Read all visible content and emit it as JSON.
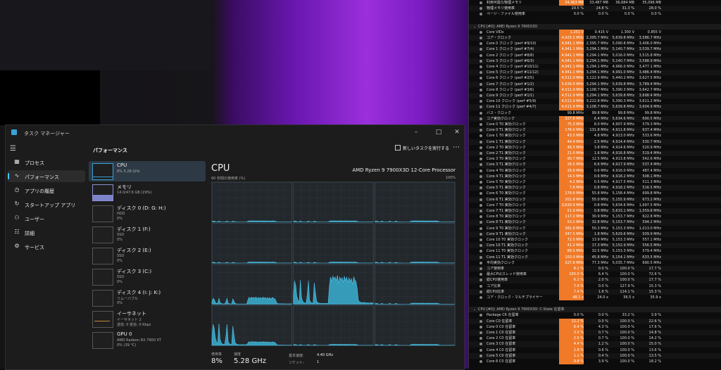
{
  "task_manager": {
    "title": "タスク マネージャー",
    "nav": [
      {
        "label": "プロセス",
        "icon": "grid-icon"
      },
      {
        "label": "パフォーマンス",
        "icon": "performance-icon"
      },
      {
        "label": "アプリの履歴",
        "icon": "history-icon"
      },
      {
        "label": "スタートアップ アプリ",
        "icon": "startup-icon"
      },
      {
        "label": "ユーザー",
        "icon": "users-icon"
      },
      {
        "label": "詳細",
        "icon": "list-icon"
      },
      {
        "label": "サービス",
        "icon": "gear-icon"
      }
    ],
    "header": {
      "title": "パフォーマンス",
      "run_task": "新しいタスクを実行する"
    },
    "resources": [
      {
        "name": "CPU",
        "line1": "8%  5.28 GHz",
        "line2": ""
      },
      {
        "name": "メモリ",
        "line1": "14.0/47.6 GB (29%)",
        "line2": ""
      },
      {
        "name": "ディスク 0 (D: G: H:)",
        "line1": "HDD",
        "line2": "0%"
      },
      {
        "name": "ディスク 1 (F:)",
        "line1": "SSD",
        "line2": "0%"
      },
      {
        "name": "ディスク 2 (E:)",
        "line1": "SSD",
        "line2": "0%"
      },
      {
        "name": "ディスク 3 (C:)",
        "line1": "SSD",
        "line2": "0%"
      },
      {
        "name": "ディスク 4 (I: J: K:)",
        "line1": "リムーバブル",
        "line2": "0%"
      },
      {
        "name": "イーサネット",
        "line1": "イーサネット 2",
        "line2": "送信: 0 受信: 0 Kbps"
      },
      {
        "name": "GPU 0",
        "line1": "AMD Radeon RX 7900 XT",
        "line2": "0% (39 °C)"
      }
    ],
    "detail": {
      "title": "CPU",
      "model": "AMD Ryzen 9 7900X3D 12-Core Processor",
      "graph_caption": "60 秒間の使用率 (%)",
      "graph_max": "100%",
      "usage_label": "使用率",
      "usage_value": "8%",
      "speed_label": "速度",
      "speed_value": "5.28 GHz",
      "base_speed_label": "基本速度:",
      "base_speed_value": "4.40 GHz",
      "sockets_label": "ソケット:",
      "sockets_value": "1"
    }
  },
  "hwinfo": {
    "highlight_color": "#f07a28",
    "rows": [
      {
        "t": "row",
        "name": "利用可能な物理メモリ",
        "v": [
          "34,463 MB",
          "33,487 MB",
          "36,684 MB",
          "35,096 MB"
        ],
        "hl": true
      },
      {
        "t": "row",
        "name": "物理メモリ使用率",
        "v": [
          "29.5 %",
          "24.8 %",
          "31.3 %",
          "28.0 %"
        ]
      },
      {
        "t": "row",
        "name": "ページ・ファイル使用率",
        "v": [
          "0.0 %",
          "0.0 %",
          "0.0 %",
          "0.0 %"
        ]
      },
      {
        "t": "gap"
      },
      {
        "t": "sec",
        "name": "CPU [#0]: AMD Ryzen 9 7900X3D"
      },
      {
        "t": "row",
        "name": "Core VIDs",
        "v": [
          "1.251 V",
          "0.415 V",
          "1.300 V",
          "0.855 V"
        ],
        "hl": true
      },
      {
        "t": "row",
        "name": "コア・クロック",
        "v": [
          "4,925.5 MHz",
          "2,395.7 MHz",
          "5,639.8 MHz",
          "3,586.7 MHz"
        ],
        "hl": true
      },
      {
        "t": "row",
        "name": "Core 0 クロック (perf #9/10)",
        "v": [
          "4,941.1 MHz",
          "2,395.7 MHz",
          "5,090.8 MHz",
          "3,406.0 MHz"
        ],
        "hl": true
      },
      {
        "t": "row",
        "name": "Core 1 クロック (perf #7/4)",
        "v": [
          "4,941.1 MHz",
          "3,294.1 MHz",
          "5,140.7 MHz",
          "3,539.7 MHz"
        ],
        "hl": true
      },
      {
        "t": "row",
        "name": "Core 2 クロック (perf #8/8)",
        "v": [
          "4,941.1 MHz",
          "3,294.1 MHz",
          "5,016.0 MHz",
          "3,515.8 MHz"
        ],
        "hl": true
      },
      {
        "t": "row",
        "name": "Core 3 クロック (perf #6/3)",
        "v": [
          "4,941.1 MHz",
          "3,294.1 MHz",
          "5,140.7 MHz",
          "3,588.9 MHz"
        ],
        "hl": true
      },
      {
        "t": "row",
        "name": "Core 4 クロック (perf #10/11)",
        "v": [
          "4,941.1 MHz",
          "3,294.1 MHz",
          "4,966.0 MHz",
          "3,477.1 MHz"
        ],
        "hl": true
      },
      {
        "t": "row",
        "name": "Core 5 クロック (perf #11/12)",
        "v": [
          "4,941.1 MHz",
          "3,294.1 MHz",
          "4,991.0 MHz",
          "3,486.4 MHz"
        ],
        "hl": true
      },
      {
        "t": "row",
        "name": "Core 6 クロック (perf #2/5)",
        "v": [
          "4,511.9 MHz",
          "3,122.9 MHz",
          "5,440.2 MHz",
          "3,627.5 MHz"
        ],
        "hl": true
      },
      {
        "t": "row",
        "name": "Core 7 クロック (perf #1/2)",
        "v": [
          "5,639.8 MHz",
          "3,294.1 MHz",
          "5,639.8 MHz",
          "3,789.4 MHz"
        ],
        "hl": true
      },
      {
        "t": "row",
        "name": "Core 8 クロック (perf #3/6)",
        "v": [
          "4,511.9 MHz",
          "3,108.7 MHz",
          "5,390.3 MHz",
          "3,642.7 MHz"
        ],
        "hl": true
      },
      {
        "t": "row",
        "name": "Core 9 クロック (perf #1/1)",
        "v": [
          "4,511.9 MHz",
          "3,294.1 MHz",
          "5,639.8 MHz",
          "3,698.4 MHz"
        ],
        "hl": true
      },
      {
        "t": "row",
        "name": "Core 10 クロック (perf #5/9)",
        "v": [
          "4,511.9 MHz",
          "3,222.8 MHz",
          "5,390.3 MHz",
          "3,611.2 MHz"
        ],
        "hl": true
      },
      {
        "t": "row",
        "name": "Core 11 クロック (perf #4/7)",
        "v": [
          "4,511.9 MHz",
          "3,108.7 MHz",
          "5,639.8 MHz",
          "3,604.9 MHz"
        ],
        "hl": true
      },
      {
        "t": "row",
        "name": "バス・クロック",
        "v": [
          "99.8 MHz",
          "99.8 MHz",
          "99.8 MHz",
          "99.8 MHz"
        ]
      },
      {
        "t": "row",
        "name": "コア実効クロック",
        "v": [
          "327.8 MHz",
          "6.4 MHz",
          "5,634.6 MHz",
          "690.5 MHz"
        ],
        "hl": true
      },
      {
        "t": "row",
        "name": "Core 0 T0 実効クロック",
        "v": [
          "75.3 MHz",
          "8.0 MHz",
          "4,907.9 MHz",
          "579.3 MHz"
        ],
        "hl": true
      },
      {
        "t": "row",
        "name": "Core 0 T1 実効クロック",
        "v": [
          "176.6 MHz",
          "131.8 MHz",
          "4,911.8 MHz",
          "637.4 MHz"
        ],
        "hl": true
      },
      {
        "t": "row",
        "name": "Core 1 T0 実効クロック",
        "v": [
          "43.5 MHz",
          "4.8 MHz",
          "4,913.0 MHz",
          "533.6 MHz"
        ],
        "hl": true
      },
      {
        "t": "row",
        "name": "Core 1 T1 実効クロック",
        "v": [
          "44.9 MHz",
          "2.5 MHz",
          "4,914.4 MHz",
          "530.7 MHz"
        ],
        "hl": true
      },
      {
        "t": "row",
        "name": "Core 2 T0 実効クロック",
        "v": [
          "46.5 MHz",
          "3.8 MHz",
          "4,914.6 MHz",
          "520.9 MHz"
        ],
        "hl": true
      },
      {
        "t": "row",
        "name": "Core 2 T1 実効クロック",
        "v": [
          "21.0 MHz",
          "1.6 MHz",
          "4,916.8 MHz",
          "519.4 MHz"
        ],
        "hl": true
      },
      {
        "t": "row",
        "name": "Core 3 T0 実効クロック",
        "v": [
          "90.7 MHz",
          "12.5 MHz",
          "4,913.8 MHz",
          "542.6 MHz"
        ],
        "hl": true
      },
      {
        "t": "row",
        "name": "Core 3 T1 実効クロック",
        "v": [
          "28.5 MHz",
          "6.6 MHz",
          "4,917.9 MHz",
          "537.4 MHz"
        ],
        "hl": true
      },
      {
        "t": "row",
        "name": "Core 4 T0 実効クロック",
        "v": [
          "26.6 MHz",
          "0.6 MHz",
          "4,916.0 MHz",
          "487.4 MHz"
        ],
        "hl": true
      },
      {
        "t": "row",
        "name": "Core 4 T1 実効クロック",
        "v": [
          "14.5 MHz",
          "0.6 MHz",
          "4,918.2 MHz",
          "508.1 MHz"
        ],
        "hl": true
      },
      {
        "t": "row",
        "name": "Core 5 T0 実効クロック",
        "v": [
          "4.2 MHz",
          "0.5 MHz",
          "4,917.5 MHz",
          "511.3 MHz"
        ],
        "hl": true
      },
      {
        "t": "row",
        "name": "Core 5 T1 実効クロック",
        "v": [
          "7.8 MHz",
          "0.8 MHz",
          "4,918.2 MHz",
          "516.5 MHz"
        ],
        "hl": true
      },
      {
        "t": "row",
        "name": "Core 6 T0 実効クロック",
        "v": [
          "176.6 MHz",
          "55.8 MHz",
          "5,158.4 MHz",
          "699.8 MHz"
        ],
        "hl": true
      },
      {
        "t": "row",
        "name": "Core 6 T1 実効クロック",
        "v": [
          "201.8 MHz",
          "55.0 MHz",
          "5,155.9 MHz",
          "673.2 MHz"
        ],
        "hl": true
      },
      {
        "t": "row",
        "name": "Core 7 T0 実効クロック",
        "v": [
          "3,630.9 MHz",
          "0.8 MHz",
          "5,634.6 MHz",
          "1,697.5 MHz"
        ],
        "hl": true
      },
      {
        "t": "row",
        "name": "Core 7 T1 実効クロック",
        "v": [
          "51.9 MHz",
          "0.8 MHz",
          "5,633.1 MHz",
          "1,559.8 MHz"
        ],
        "hl": true
      },
      {
        "t": "row",
        "name": "Core 8 T0 実効クロック",
        "v": [
          "117.2 MHz",
          "30.9 MHz",
          "5,153.7 MHz",
          "622.8 MHz"
        ],
        "hl": true
      },
      {
        "t": "row",
        "name": "Core 8 T1 実効クロック",
        "v": [
          "53.2 MHz",
          "32.8 MHz",
          "5,153.7 MHz",
          "594.2 MHz"
        ],
        "hl": true
      },
      {
        "t": "row",
        "name": "Core 9 T0 実効クロック",
        "v": [
          "381.8 MHz",
          "50.3 MHz",
          "5,153.3 MHz",
          "1,013.0 MHz"
        ],
        "hl": true
      },
      {
        "t": "row",
        "name": "Core 9 T1 実効クロック",
        "v": [
          "347.5 MHz",
          "1.8 MHz",
          "5,629.6 MHz",
          "939.9 MHz"
        ],
        "hl": true
      },
      {
        "t": "row",
        "name": "Core 10 T0 実効クロック",
        "v": [
          "72.5 MHz",
          "13.9 MHz",
          "5,153.3 MHz",
          "557.1 MHz"
        ],
        "hl": true
      },
      {
        "t": "row",
        "name": "Core 10 T1 実効クロック",
        "v": [
          "41.2 MHz",
          "17.3 MHz",
          "5,152.9 MHz",
          "556.5 MHz"
        ],
        "hl": true
      },
      {
        "t": "row",
        "name": "Core 11 T0 実効クロック",
        "v": [
          "88.5 MHz",
          "32.5 MHz",
          "5,153.3 MHz",
          "579.4 MHz"
        ],
        "hl": true
      },
      {
        "t": "row",
        "name": "Core 11 T1 実効クロック",
        "v": [
          "103.0 MHz",
          "45.8 MHz",
          "5,154.1 MHz",
          "633.5 MHz"
        ],
        "hl": true
      },
      {
        "t": "row",
        "name": "平均実効クロック",
        "v": [
          "327.8 MHz",
          "77.3 MHz",
          "5,035.7 MHz",
          "690.5 MHz"
        ],
        "hl": true
      },
      {
        "t": "row",
        "name": "コア使用率",
        "v": [
          "6.1 %",
          "0.0 %",
          "100.0 %",
          "17.7 %"
        ],
        "hl": true
      },
      {
        "t": "row",
        "name": "最大CPU/スレッド使用率",
        "v": [
          "100.0 %",
          "6.4 %",
          "100.0 %",
          "72.6 %"
        ],
        "hl": true
      },
      {
        "t": "row",
        "name": "総CPU使用率",
        "v": [
          "6.1 %",
          "2.0 %",
          "100.0 %",
          "17.7 %"
        ],
        "hl": true
      },
      {
        "t": "row",
        "name": "コア比率",
        "v": [
          "7.4 %",
          "0.0 %",
          "127.9 %",
          "15.3 %"
        ],
        "hl": true
      },
      {
        "t": "row",
        "name": "総CPU比率",
        "v": [
          "7.4 %",
          "1.6 %",
          "114.1 %",
          "15.3 %"
        ],
        "hl": true
      },
      {
        "t": "row",
        "name": "コア・クロック・マルチプライヤー",
        "v": [
          "48.1 x",
          "24.0 x",
          "56.5 x",
          "35.9 x"
        ],
        "hl": true
      },
      {
        "t": "gap"
      },
      {
        "t": "sec",
        "name": "CPU [#0]: AMD Ryzen 9 7900X3D: C-State 在留率"
      },
      {
        "t": "row",
        "name": "Package C6 在留率",
        "v": [
          "0.0 %",
          "0.0 %",
          "33.2 %",
          "3.9 %"
        ]
      },
      {
        "t": "row",
        "name": "Core C0 在留率",
        "v": [
          "12.2 %",
          "0.0 %",
          "100.0 %",
          "22.6 %"
        ],
        "hl": true
      },
      {
        "t": "row",
        "name": "Core 0 C0 在留率",
        "v": [
          "6.4 %",
          "4.3 %",
          "100.0 %",
          "17.6 %"
        ],
        "hl": true
      },
      {
        "t": "row",
        "name": "Core 1 C0 在留率",
        "v": [
          "3.5 %",
          "0.7 %",
          "100.0 %",
          "14.8 %"
        ],
        "hl": true
      },
      {
        "t": "row",
        "name": "Core 2 C0 在留率",
        "v": [
          "2.5 %",
          "0.7 %",
          "100.0 %",
          "14.2 %"
        ],
        "hl": true
      },
      {
        "t": "row",
        "name": "Core 3 C0 在留率",
        "v": [
          "4.4 %",
          "1.2 %",
          "100.0 %",
          "15.0 %"
        ],
        "hl": true
      },
      {
        "t": "row",
        "name": "Core 4 C0 在留率",
        "v": [
          "1.8 %",
          "0.6 %",
          "100.0 %",
          "13.6 %"
        ],
        "hl": true
      },
      {
        "t": "row",
        "name": "Core 5 C0 在留率",
        "v": [
          "1.1 %",
          "0.4 %",
          "100.0 %",
          "13.5 %"
        ],
        "hl": true
      },
      {
        "t": "row",
        "name": "Core 6 C0 在留率",
        "v": [
          "9.8 %",
          "3.9 %",
          "100.0 %",
          "18.2 %"
        ],
        "hl": true
      }
    ]
  },
  "chart_data": {
    "type": "area",
    "title": "CPU",
    "xlabel": "60 秒間の使用率 (%)",
    "ylabel": "",
    "ylim": [
      0,
      100
    ],
    "grid": true,
    "series": [
      {
        "values": [
          22,
          60,
          48,
          20,
          10,
          5,
          62,
          18,
          8,
          4,
          3,
          3,
          24,
          60,
          10,
          5,
          3,
          3,
          55,
          30,
          8,
          4,
          3,
          2,
          2,
          2,
          2,
          2,
          2,
          2,
          2,
          45,
          70,
          58,
          72,
          64,
          70,
          60,
          74,
          52,
          70,
          62,
          68,
          56,
          72,
          60,
          70,
          55,
          68,
          58,
          66,
          50,
          70,
          62,
          58,
          40,
          10,
          6,
          5,
          4,
          4,
          5,
          3,
          4,
          3,
          3,
          3,
          4,
          3,
          3
        ]
      }
    ]
  }
}
